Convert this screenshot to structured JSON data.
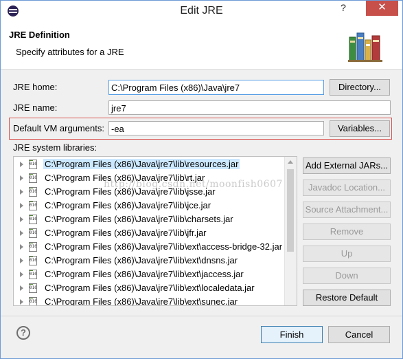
{
  "window": {
    "title": "Edit JRE",
    "help_glyph": "?",
    "close_glyph": "✕"
  },
  "header": {
    "title": "JRE Definition",
    "description": "Specify attributes for a JRE",
    "icon": "books-icon"
  },
  "form": {
    "jre_home_label": "JRE home:",
    "jre_home_value": "C:\\Program Files (x86)\\Java\\jre7",
    "directory_button": "Directory...",
    "jre_name_label": "JRE name:",
    "jre_name_value": "jre7",
    "vm_args_label": "Default VM arguments:",
    "vm_args_value": "-ea",
    "variables_button": "Variables...",
    "libraries_label": "JRE system libraries:"
  },
  "libraries": [
    {
      "path": "C:\\Program Files (x86)\\Java\\jre7\\lib\\resources.jar",
      "selected": true
    },
    {
      "path": "C:\\Program Files (x86)\\Java\\jre7\\lib\\rt.jar",
      "selected": false
    },
    {
      "path": "C:\\Program Files (x86)\\Java\\jre7\\lib\\jsse.jar",
      "selected": false
    },
    {
      "path": "C:\\Program Files (x86)\\Java\\jre7\\lib\\jce.jar",
      "selected": false
    },
    {
      "path": "C:\\Program Files (x86)\\Java\\jre7\\lib\\charsets.jar",
      "selected": false
    },
    {
      "path": "C:\\Program Files (x86)\\Java\\jre7\\lib\\jfr.jar",
      "selected": false
    },
    {
      "path": "C:\\Program Files (x86)\\Java\\jre7\\lib\\ext\\access-bridge-32.jar",
      "selected": false
    },
    {
      "path": "C:\\Program Files (x86)\\Java\\jre7\\lib\\ext\\dnsns.jar",
      "selected": false
    },
    {
      "path": "C:\\Program Files (x86)\\Java\\jre7\\lib\\ext\\jaccess.jar",
      "selected": false
    },
    {
      "path": "C:\\Program Files (x86)\\Java\\jre7\\lib\\ext\\localedata.jar",
      "selected": false
    },
    {
      "path": "C:\\Program Files (x86)\\Java\\jre7\\lib\\ext\\sunec.jar",
      "selected": false
    }
  ],
  "jar_icon_text": "010",
  "side_buttons": {
    "add_external": "Add External JARs...",
    "javadoc": "Javadoc Location...",
    "source": "Source Attachment...",
    "remove": "Remove",
    "up": "Up",
    "down": "Down",
    "restore": "Restore Default"
  },
  "footer": {
    "help_glyph": "?",
    "finish": "Finish",
    "cancel": "Cancel"
  },
  "watermark": "http://blog.csdn.net/moonfish0607",
  "colors": {
    "highlight_border": "#d9534f",
    "selection": "#cce8ff",
    "close_button": "#c7504b"
  }
}
